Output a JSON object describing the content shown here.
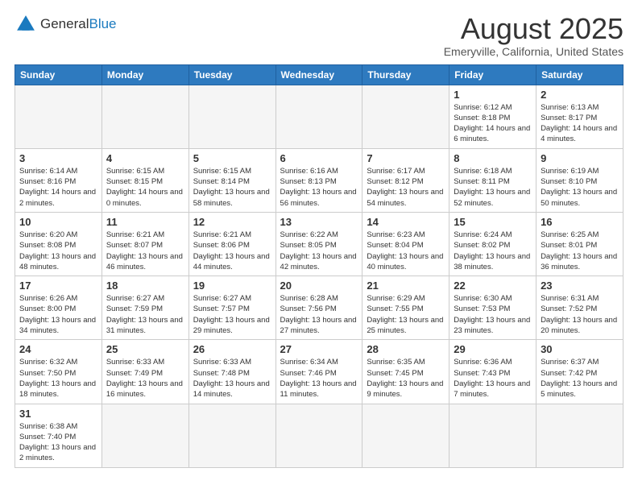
{
  "logo": {
    "text_general": "General",
    "text_blue": "Blue"
  },
  "title": "August 2025",
  "subtitle": "Emeryville, California, United States",
  "weekdays": [
    "Sunday",
    "Monday",
    "Tuesday",
    "Wednesday",
    "Thursday",
    "Friday",
    "Saturday"
  ],
  "weeks": [
    [
      {
        "day": "",
        "info": "",
        "empty": true
      },
      {
        "day": "",
        "info": "",
        "empty": true
      },
      {
        "day": "",
        "info": "",
        "empty": true
      },
      {
        "day": "",
        "info": "",
        "empty": true
      },
      {
        "day": "",
        "info": "",
        "empty": true
      },
      {
        "day": "1",
        "info": "Sunrise: 6:12 AM\nSunset: 8:18 PM\nDaylight: 14 hours and 6 minutes.",
        "empty": false
      },
      {
        "day": "2",
        "info": "Sunrise: 6:13 AM\nSunset: 8:17 PM\nDaylight: 14 hours and 4 minutes.",
        "empty": false
      }
    ],
    [
      {
        "day": "3",
        "info": "Sunrise: 6:14 AM\nSunset: 8:16 PM\nDaylight: 14 hours and 2 minutes.",
        "empty": false
      },
      {
        "day": "4",
        "info": "Sunrise: 6:15 AM\nSunset: 8:15 PM\nDaylight: 14 hours and 0 minutes.",
        "empty": false
      },
      {
        "day": "5",
        "info": "Sunrise: 6:15 AM\nSunset: 8:14 PM\nDaylight: 13 hours and 58 minutes.",
        "empty": false
      },
      {
        "day": "6",
        "info": "Sunrise: 6:16 AM\nSunset: 8:13 PM\nDaylight: 13 hours and 56 minutes.",
        "empty": false
      },
      {
        "day": "7",
        "info": "Sunrise: 6:17 AM\nSunset: 8:12 PM\nDaylight: 13 hours and 54 minutes.",
        "empty": false
      },
      {
        "day": "8",
        "info": "Sunrise: 6:18 AM\nSunset: 8:11 PM\nDaylight: 13 hours and 52 minutes.",
        "empty": false
      },
      {
        "day": "9",
        "info": "Sunrise: 6:19 AM\nSunset: 8:10 PM\nDaylight: 13 hours and 50 minutes.",
        "empty": false
      }
    ],
    [
      {
        "day": "10",
        "info": "Sunrise: 6:20 AM\nSunset: 8:08 PM\nDaylight: 13 hours and 48 minutes.",
        "empty": false
      },
      {
        "day": "11",
        "info": "Sunrise: 6:21 AM\nSunset: 8:07 PM\nDaylight: 13 hours and 46 minutes.",
        "empty": false
      },
      {
        "day": "12",
        "info": "Sunrise: 6:21 AM\nSunset: 8:06 PM\nDaylight: 13 hours and 44 minutes.",
        "empty": false
      },
      {
        "day": "13",
        "info": "Sunrise: 6:22 AM\nSunset: 8:05 PM\nDaylight: 13 hours and 42 minutes.",
        "empty": false
      },
      {
        "day": "14",
        "info": "Sunrise: 6:23 AM\nSunset: 8:04 PM\nDaylight: 13 hours and 40 minutes.",
        "empty": false
      },
      {
        "day": "15",
        "info": "Sunrise: 6:24 AM\nSunset: 8:02 PM\nDaylight: 13 hours and 38 minutes.",
        "empty": false
      },
      {
        "day": "16",
        "info": "Sunrise: 6:25 AM\nSunset: 8:01 PM\nDaylight: 13 hours and 36 minutes.",
        "empty": false
      }
    ],
    [
      {
        "day": "17",
        "info": "Sunrise: 6:26 AM\nSunset: 8:00 PM\nDaylight: 13 hours and 34 minutes.",
        "empty": false
      },
      {
        "day": "18",
        "info": "Sunrise: 6:27 AM\nSunset: 7:59 PM\nDaylight: 13 hours and 31 minutes.",
        "empty": false
      },
      {
        "day": "19",
        "info": "Sunrise: 6:27 AM\nSunset: 7:57 PM\nDaylight: 13 hours and 29 minutes.",
        "empty": false
      },
      {
        "day": "20",
        "info": "Sunrise: 6:28 AM\nSunset: 7:56 PM\nDaylight: 13 hours and 27 minutes.",
        "empty": false
      },
      {
        "day": "21",
        "info": "Sunrise: 6:29 AM\nSunset: 7:55 PM\nDaylight: 13 hours and 25 minutes.",
        "empty": false
      },
      {
        "day": "22",
        "info": "Sunrise: 6:30 AM\nSunset: 7:53 PM\nDaylight: 13 hours and 23 minutes.",
        "empty": false
      },
      {
        "day": "23",
        "info": "Sunrise: 6:31 AM\nSunset: 7:52 PM\nDaylight: 13 hours and 20 minutes.",
        "empty": false
      }
    ],
    [
      {
        "day": "24",
        "info": "Sunrise: 6:32 AM\nSunset: 7:50 PM\nDaylight: 13 hours and 18 minutes.",
        "empty": false
      },
      {
        "day": "25",
        "info": "Sunrise: 6:33 AM\nSunset: 7:49 PM\nDaylight: 13 hours and 16 minutes.",
        "empty": false
      },
      {
        "day": "26",
        "info": "Sunrise: 6:33 AM\nSunset: 7:48 PM\nDaylight: 13 hours and 14 minutes.",
        "empty": false
      },
      {
        "day": "27",
        "info": "Sunrise: 6:34 AM\nSunset: 7:46 PM\nDaylight: 13 hours and 11 minutes.",
        "empty": false
      },
      {
        "day": "28",
        "info": "Sunrise: 6:35 AM\nSunset: 7:45 PM\nDaylight: 13 hours and 9 minutes.",
        "empty": false
      },
      {
        "day": "29",
        "info": "Sunrise: 6:36 AM\nSunset: 7:43 PM\nDaylight: 13 hours and 7 minutes.",
        "empty": false
      },
      {
        "day": "30",
        "info": "Sunrise: 6:37 AM\nSunset: 7:42 PM\nDaylight: 13 hours and 5 minutes.",
        "empty": false
      }
    ],
    [
      {
        "day": "31",
        "info": "Sunrise: 6:38 AM\nSunset: 7:40 PM\nDaylight: 13 hours and 2 minutes.",
        "empty": false
      },
      {
        "day": "",
        "info": "",
        "empty": true
      },
      {
        "day": "",
        "info": "",
        "empty": true
      },
      {
        "day": "",
        "info": "",
        "empty": true
      },
      {
        "day": "",
        "info": "",
        "empty": true
      },
      {
        "day": "",
        "info": "",
        "empty": true
      },
      {
        "day": "",
        "info": "",
        "empty": true
      }
    ]
  ]
}
